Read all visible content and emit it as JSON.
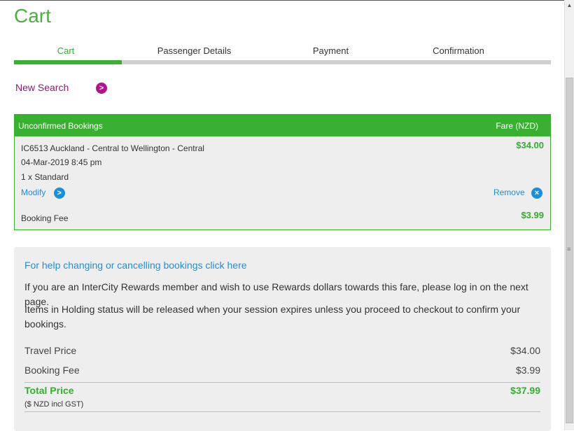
{
  "title": "Cart",
  "steps": [
    "Cart",
    "Passenger Details",
    "Payment",
    "Confirmation"
  ],
  "new_search": "New Search",
  "bookings": {
    "header_left": "Unconfirmed Bookings",
    "header_right": "Fare (NZD)",
    "route": "IC6513 Auckland - Central to Wellington - Central",
    "datetime": "04-Mar-2019 8:45 pm",
    "passengers": "1 x Standard",
    "fare": "$34.00",
    "modify": "Modify",
    "remove": "Remove",
    "booking_fee_label": "Booking Fee",
    "booking_fee": "$3.99"
  },
  "info": {
    "help_link": "For help changing or cancelling bookings click here",
    "rewards_text": "If you are an InterCity Rewards member and wish to use Rewards dollars towards this fare, please log in on the next page.",
    "holding_text": "Items in Holding status will be released when your session expires unless you proceed to checkout to confirm your bookings.",
    "travel_price_label": "Travel Price",
    "travel_price": "$34.00",
    "booking_fee_label": "Booking Fee",
    "booking_fee": "$3.99",
    "total_label": "Total Price",
    "total": "$37.99",
    "gst_note": "($ NZD incl GST)"
  },
  "colors": {
    "green": "#3ab033",
    "blue": "#1e8fd6",
    "purple": "#8b1a73"
  }
}
